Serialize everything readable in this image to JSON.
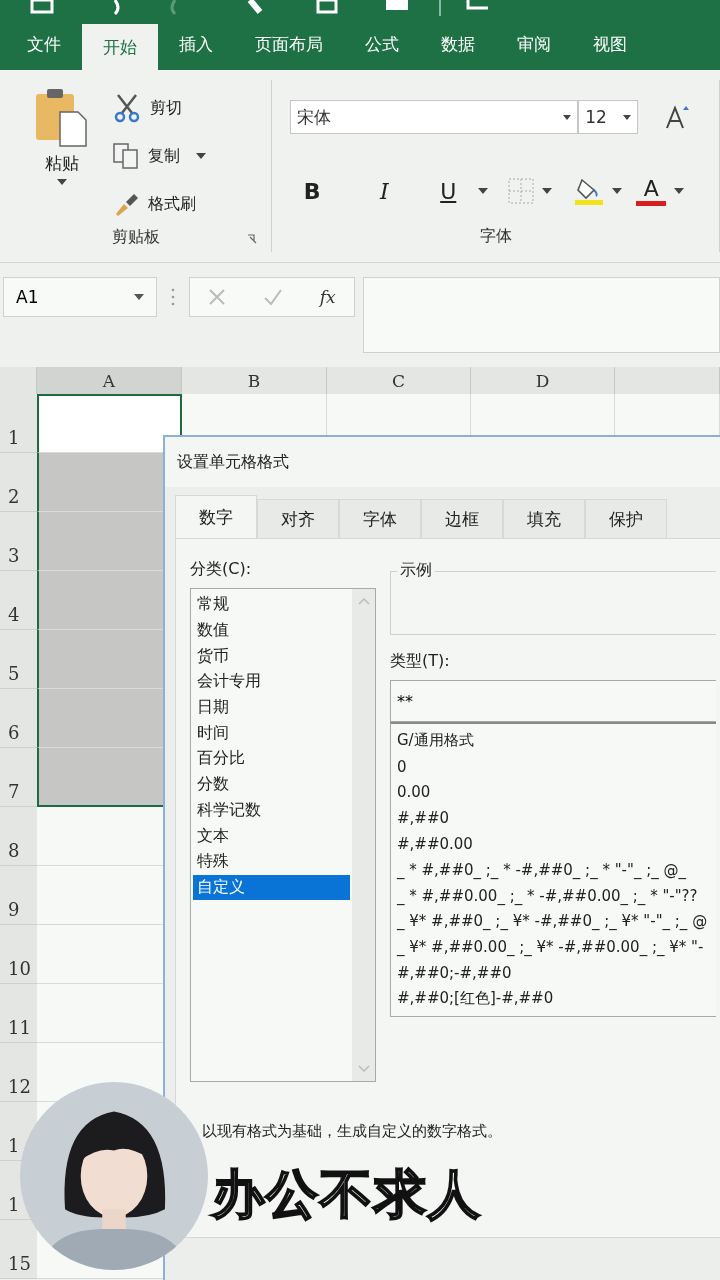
{
  "ribbon_tabs": [
    {
      "label": "文件",
      "selected": false
    },
    {
      "label": "开始",
      "selected": true
    },
    {
      "label": "插入",
      "selected": false
    },
    {
      "label": "页面布局",
      "selected": false
    },
    {
      "label": "公式",
      "selected": false
    },
    {
      "label": "数据",
      "selected": false
    },
    {
      "label": "审阅",
      "selected": false
    },
    {
      "label": "视图",
      "selected": false
    }
  ],
  "clipboard": {
    "paste": "粘贴",
    "cut": "剪切",
    "copy": "复制",
    "format_painter": "格式刷",
    "group_label": "剪贴板"
  },
  "font": {
    "name": "宋体",
    "size": "12",
    "bold": "B",
    "italic": "I",
    "underline": "U",
    "font_color": "A",
    "group_label": "字体"
  },
  "formula_bar": {
    "name_box": "A1",
    "fx": "fx"
  },
  "columns": [
    {
      "label": "A",
      "selected": true
    },
    {
      "label": "B",
      "selected": false
    },
    {
      "label": "C",
      "selected": false
    },
    {
      "label": "D",
      "selected": false
    }
  ],
  "rows": [
    {
      "label": "1",
      "a_selected": true,
      "a_active": true
    },
    {
      "label": "2",
      "a_selected": true,
      "a_active": false
    },
    {
      "label": "3",
      "a_selected": true,
      "a_active": false
    },
    {
      "label": "4",
      "a_selected": true,
      "a_active": false
    },
    {
      "label": "5",
      "a_selected": true,
      "a_active": false
    },
    {
      "label": "6",
      "a_selected": true,
      "a_active": false
    },
    {
      "label": "7",
      "a_selected": true,
      "a_active": false
    },
    {
      "label": "8",
      "a_selected": false,
      "a_active": false
    },
    {
      "label": "9",
      "a_selected": false,
      "a_active": false
    },
    {
      "label": "10",
      "a_selected": false,
      "a_active": false
    },
    {
      "label": "11",
      "a_selected": false,
      "a_active": false
    },
    {
      "label": "12",
      "a_selected": false,
      "a_active": false
    },
    {
      "label": "1",
      "a_selected": false,
      "a_active": false
    },
    {
      "label": "1"
    },
    {
      "label": "15",
      "a_selected": false,
      "a_active": false
    }
  ],
  "dialog": {
    "title": "设置单元格格式",
    "tabs": [
      {
        "label": "数字",
        "selected": true
      },
      {
        "label": "对齐",
        "selected": false
      },
      {
        "label": "字体",
        "selected": false
      },
      {
        "label": "边框",
        "selected": false
      },
      {
        "label": "填充",
        "selected": false
      },
      {
        "label": "保护",
        "selected": false
      }
    ],
    "category_label": "分类(C):",
    "categories": [
      {
        "label": "常规",
        "selected": false
      },
      {
        "label": "数值",
        "selected": false
      },
      {
        "label": "货币",
        "selected": false
      },
      {
        "label": "会计专用",
        "selected": false
      },
      {
        "label": "日期",
        "selected": false
      },
      {
        "label": "时间",
        "selected": false
      },
      {
        "label": "百分比",
        "selected": false
      },
      {
        "label": "分数",
        "selected": false
      },
      {
        "label": "科学记数",
        "selected": false
      },
      {
        "label": "文本",
        "selected": false
      },
      {
        "label": "特殊",
        "selected": false
      },
      {
        "label": "自定义",
        "selected": true
      }
    ],
    "sample_label": "示例",
    "type_label": "类型(T):",
    "type_value": "**",
    "formats": [
      "G/通用格式",
      "0",
      "0.00",
      "#,##0",
      "#,##0.00",
      "_ * #,##0_ ;_ * -#,##0_ ;_ * \"-\"_ ;_ @_",
      "_ * #,##0.00_ ;_ * -#,##0.00_ ;_ * \"-\"??",
      "_ ¥* #,##0_ ;_ ¥* -#,##0_ ;_ ¥* \"-\"_ ;_ @",
      "_ ¥* #,##0.00_ ;_ ¥* -#,##0.00_ ;_ ¥* \"-",
      "#,##0;-#,##0",
      "#,##0;[红色]-#,##0"
    ],
    "description": "以现有格式为基础，生成自定义的数字格式。"
  },
  "overlay": {
    "caption": "办公不求人"
  }
}
